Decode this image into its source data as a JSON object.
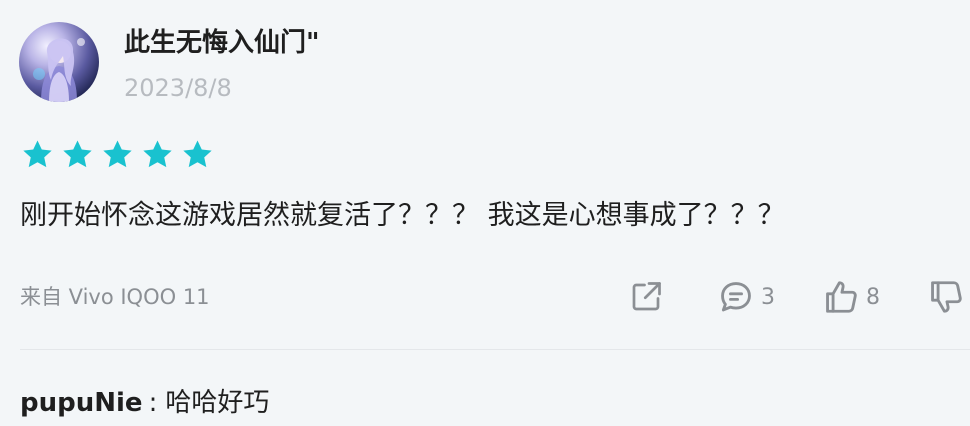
{
  "review": {
    "username": "此生无悔入仙门\"",
    "date": "2023/8/8",
    "rating": 5,
    "rating_color": "#19c2cf",
    "content": "刚开始怀念这游戏居然就复活了？？？ 我这是心想事成了？？？",
    "device": "来自 Vivo IQOO 11",
    "avatar_icon": "anime-character-avatar"
  },
  "actions": {
    "share_icon": "share-icon",
    "comment_icon": "comment-icon",
    "comment_count": "3",
    "like_icon": "thumbs-up-icon",
    "like_count": "8",
    "dislike_icon": "thumbs-down-icon"
  },
  "reply": {
    "user": "pupuNie",
    "separator": ":",
    "text": "哈哈好巧"
  }
}
